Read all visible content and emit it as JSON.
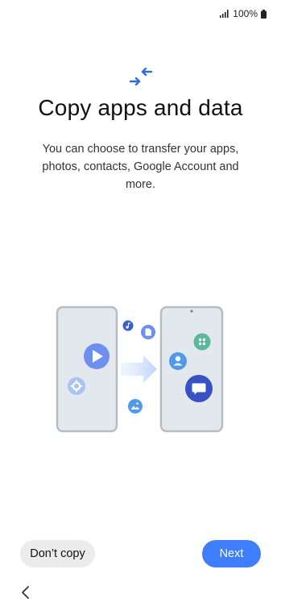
{
  "status_bar": {
    "battery_text": "100%",
    "icons": [
      "signal-icon",
      "battery-icon"
    ]
  },
  "header": {
    "icon": "transfer-arrows-icon",
    "title": "Copy apps and data",
    "description": "You can choose to transfer your apps, photos, contacts, Google Account and more."
  },
  "illustration": {
    "icons": [
      "play-icon",
      "settings-icon",
      "music-icon",
      "file-icon",
      "image-icon",
      "arrow-right-icon",
      "apps-icon",
      "contact-icon",
      "message-icon"
    ]
  },
  "footer": {
    "secondary_label": "Don’t copy",
    "primary_label": "Next",
    "back_icon": "chevron-left-icon"
  },
  "colors": {
    "accent": "#3e7dfb",
    "icon_blue": "#2a6fdb"
  }
}
